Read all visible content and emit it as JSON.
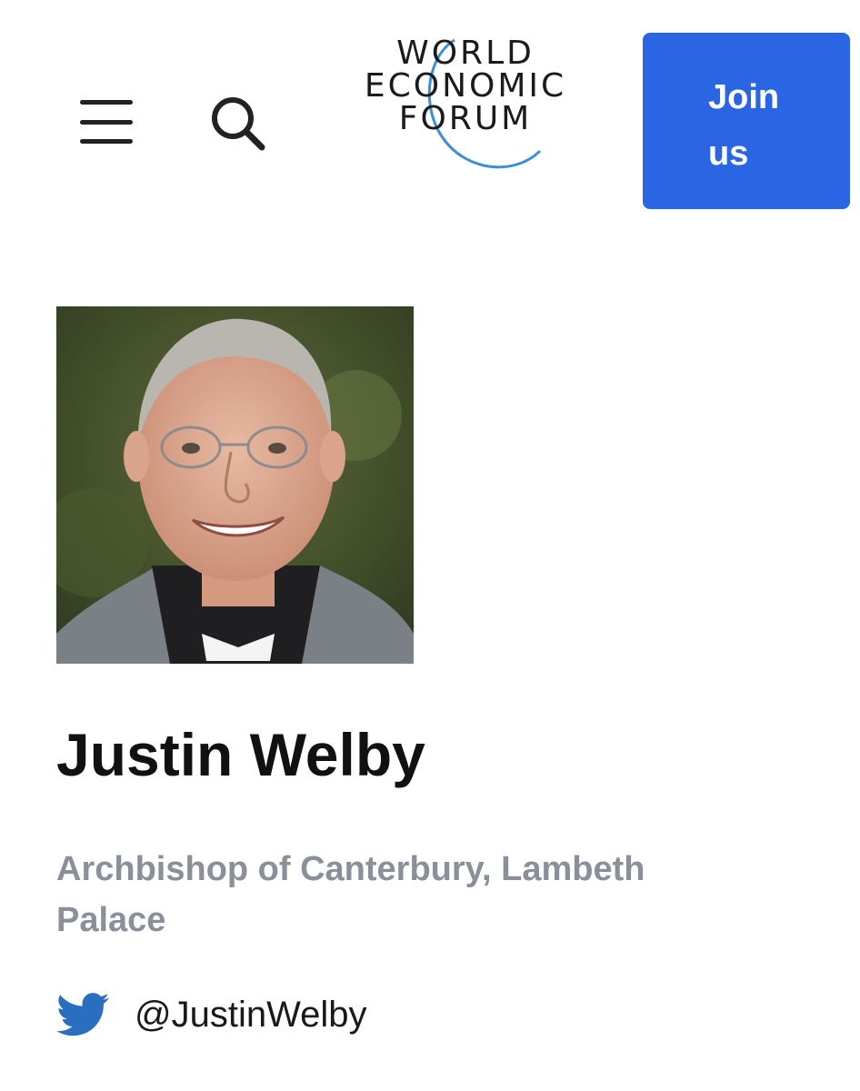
{
  "header": {
    "menu_icon": "hamburger-menu-icon",
    "search_icon": "search-icon",
    "logo": {
      "line1": "WORLD",
      "line2": "ECONOMIC",
      "line3": "FORUM"
    },
    "join_label": "Join\nus",
    "join_color": "#2a66e3"
  },
  "profile": {
    "photo_alt": "Justin Welby",
    "name": "Justin Welby",
    "role": "Archbishop of Canterbury, Lambeth Palace",
    "twitter_icon": "twitter-bird-icon",
    "twitter_handle": "@JustinWelby",
    "twitter_color": "#2a6fbf"
  }
}
